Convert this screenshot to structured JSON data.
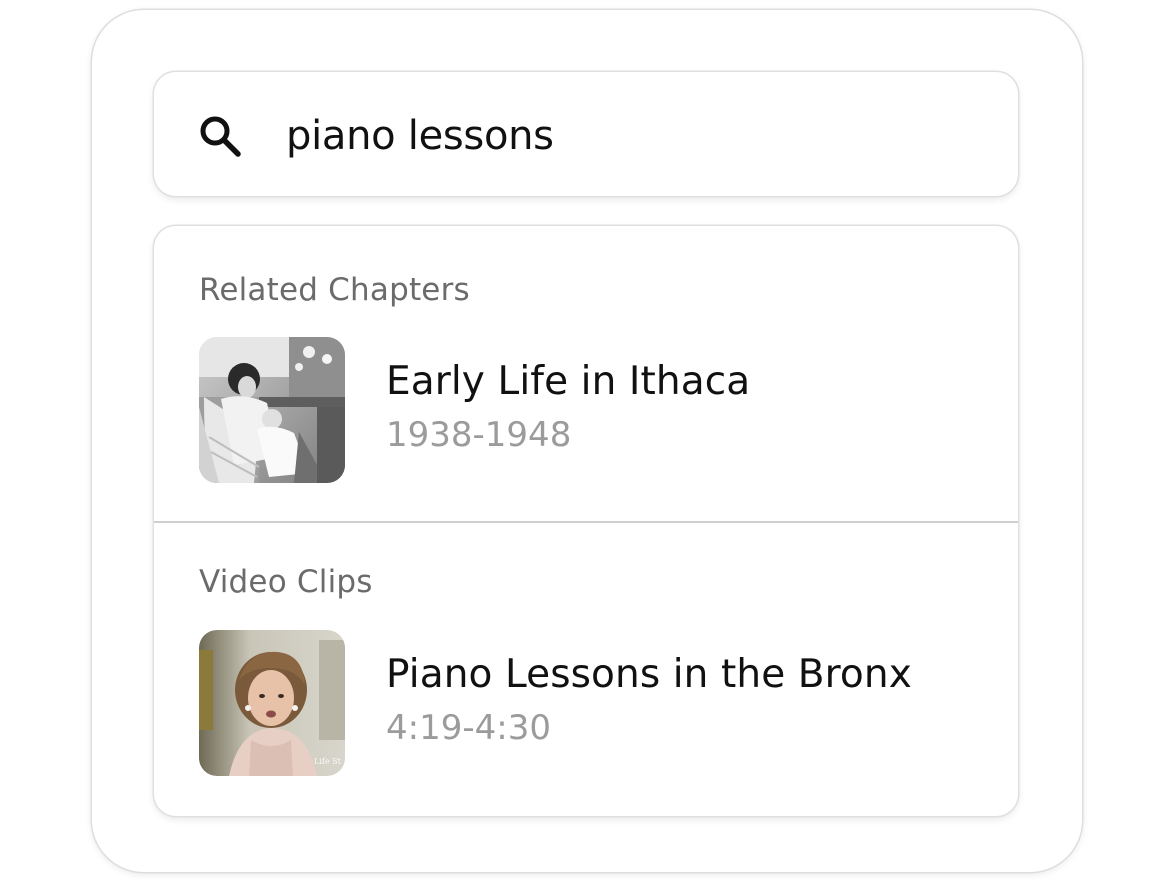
{
  "search": {
    "query": "piano lessons",
    "icon": "search-icon"
  },
  "sections": [
    {
      "label": "Related Chapters",
      "items": [
        {
          "title": "Early Life in Ithaca",
          "subtitle": "1938-1948",
          "thumbnail": "vintage-family-photo"
        }
      ]
    },
    {
      "label": "Video Clips",
      "items": [
        {
          "title": "Piano Lessons in the Bronx",
          "subtitle": "4:19-4:30",
          "thumbnail": "interview-video-frame",
          "watermark": "Life St"
        }
      ]
    }
  ]
}
